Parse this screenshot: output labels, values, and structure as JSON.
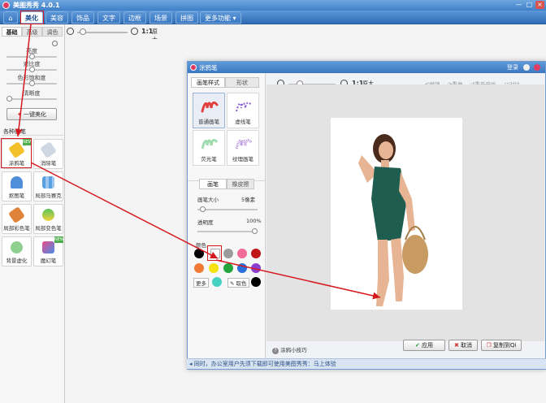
{
  "app": {
    "title": "美图秀秀 4.0.1"
  },
  "titlebar_buttons": [
    "—",
    "□",
    "×"
  ],
  "menu": {
    "home": "⌂",
    "tabs": [
      "美化",
      "美容",
      "饰品",
      "文字",
      "边框",
      "场景",
      "拼图",
      "更多功能"
    ],
    "more_arrow": "▾"
  },
  "left_panel": {
    "subtabs": [
      "基础",
      "高级",
      "调色"
    ],
    "sliders": [
      {
        "label": "亮度",
        "value": 0.5
      },
      {
        "label": "对比度",
        "value": 0.5
      },
      {
        "label": "色彩饱和度",
        "value": 0.5
      },
      {
        "label": "清晰度",
        "value": 0.0
      }
    ],
    "one_click_button": "一键美化",
    "brushes_heading": "各种画笔",
    "tools": [
      {
        "label": "涂鸦笔",
        "icon": "pencil-icon",
        "new": true
      },
      {
        "label": "消除笔",
        "icon": "eraser-icon",
        "new": false
      },
      {
        "label": "抠图笔",
        "icon": "pen-nib-icon",
        "new": false
      },
      {
        "label": "局部马赛克",
        "icon": "mosaic-icon",
        "new": false
      },
      {
        "label": "局部彩色笔",
        "icon": "color-pen-icon",
        "new": false
      },
      {
        "label": "局部变色笔",
        "icon": "tint-pen-icon",
        "new": false
      },
      {
        "label": "背景虚化",
        "icon": "blur-icon",
        "new": false
      },
      {
        "label": "魔幻笔",
        "icon": "magic-pen-icon",
        "new": true
      }
    ],
    "new_badge": "NEW"
  },
  "main_zoom": {
    "ratio": "1:1",
    "fit_label": "原大"
  },
  "dialog": {
    "title": "涂鸦笔",
    "login": "登录",
    "tabs": [
      "画笔样式",
      "形状"
    ],
    "brushes": [
      {
        "label": "普通画笔",
        "selected": true,
        "color": "#e43f3f"
      },
      {
        "label": "虚线笔",
        "selected": false,
        "color": "#8a5fd6"
      },
      {
        "label": "荧光笔",
        "selected": false,
        "color": "#62c57b"
      },
      {
        "label": "纹理画笔",
        "selected": false,
        "color": "#b38fdf"
      }
    ],
    "mode_tabs": [
      "画笔",
      "橡皮擦"
    ],
    "size_label": "画笔大小",
    "size_value": "5像素",
    "size_fraction": 0.05,
    "opacity_label": "透明度",
    "opacity_value": "100%",
    "opacity_fraction": 1.0,
    "color_label": "颜色",
    "colors": [
      "#000000",
      "#ffffff",
      "#9b9b9b",
      "#f06b98",
      "#c01616",
      "#f07a35",
      "#f5e20e",
      "#23a53d",
      "#2b6fd9",
      "#8a3fd0"
    ],
    "more_label": "更多",
    "more_swatch": "#47d1c5",
    "picker_label": "取色",
    "picker_swatch": "#000000",
    "zoom": {
      "ratio": "1:1",
      "fit_label": "原大"
    },
    "toolbar": [
      "撤销",
      "重做",
      "重新开始",
      "对比"
    ],
    "tips_label": "涂鸦小技巧",
    "buttons": {
      "apply": "应用",
      "cancel": "取消",
      "copy": "复制到Qi"
    }
  },
  "statusbar": {
    "text": "同时，办公室用户先须下载即可使用美图秀秀：马上体验"
  },
  "annotation_color": "#d6181e"
}
